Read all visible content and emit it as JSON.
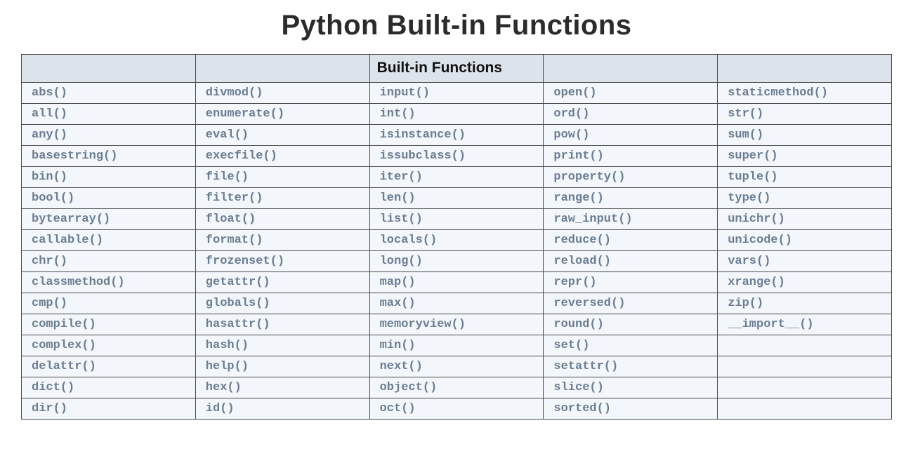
{
  "title": "Python Built-in Functions",
  "header": {
    "c0": "",
    "c1": "",
    "c2": "Built-in Functions",
    "c3": "",
    "c4": ""
  },
  "rows": [
    {
      "c0": "abs()",
      "c1": "divmod()",
      "c2": "input()",
      "c3": "open()",
      "c4": "staticmethod()"
    },
    {
      "c0": "all()",
      "c1": "enumerate()",
      "c2": "int()",
      "c3": "ord()",
      "c4": "str()"
    },
    {
      "c0": "any()",
      "c1": "eval()",
      "c2": "isinstance()",
      "c3": "pow()",
      "c4": "sum()"
    },
    {
      "c0": "basestring()",
      "c1": "execfile()",
      "c2": "issubclass()",
      "c3": "print()",
      "c4": "super()"
    },
    {
      "c0": "bin()",
      "c1": "file()",
      "c2": "iter()",
      "c3": "property()",
      "c4": "tuple()"
    },
    {
      "c0": "bool()",
      "c1": "filter()",
      "c2": "len()",
      "c3": "range()",
      "c4": "type()"
    },
    {
      "c0": "bytearray()",
      "c1": "float()",
      "c2": "list()",
      "c3": "raw_input()",
      "c4": "unichr()"
    },
    {
      "c0": "callable()",
      "c1": "format()",
      "c2": "locals()",
      "c3": "reduce()",
      "c4": "unicode()"
    },
    {
      "c0": "chr()",
      "c1": "frozenset()",
      "c2": "long()",
      "c3": "reload()",
      "c4": "vars()"
    },
    {
      "c0": "classmethod()",
      "c1": "getattr()",
      "c2": "map()",
      "c3": "repr()",
      "c4": "xrange()"
    },
    {
      "c0": "cmp()",
      "c1": "globals()",
      "c2": "max()",
      "c3": "reversed()",
      "c4": "zip()"
    },
    {
      "c0": "compile()",
      "c1": "hasattr()",
      "c2": "memoryview()",
      "c3": "round()",
      "c4": "__import__()"
    },
    {
      "c0": "complex()",
      "c1": "hash()",
      "c2": "min()",
      "c3": "set()",
      "c4": ""
    },
    {
      "c0": "delattr()",
      "c1": "help()",
      "c2": "next()",
      "c3": "setattr()",
      "c4": ""
    },
    {
      "c0": "dict()",
      "c1": "hex()",
      "c2": "object()",
      "c3": "slice()",
      "c4": ""
    },
    {
      "c0": "dir()",
      "c1": "id()",
      "c2": "oct()",
      "c3": "sorted()",
      "c4": ""
    }
  ]
}
